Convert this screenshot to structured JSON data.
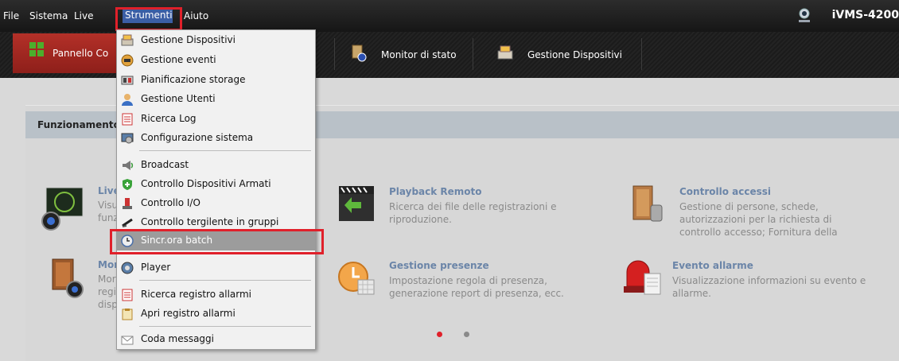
{
  "menubar": {
    "items": [
      "File",
      "Sistema",
      "Live",
      "Strumenti",
      "Aiuto"
    ],
    "active": "Strumenti",
    "brand": "iVMS-4200"
  },
  "toolbar": {
    "tabs": [
      {
        "label": "Pannello Co",
        "icon": "grid-icon",
        "active": true
      },
      {
        "label": "Monitor di stato",
        "icon": "status-monitor-icon"
      },
      {
        "label": "Gestione Dispositivi",
        "icon": "device-icon"
      }
    ]
  },
  "section": {
    "title": "Funzionamento"
  },
  "cards": [
    {
      "title": "Live",
      "desc": [
        "Visu",
        "funz"
      ]
    },
    {
      "title": "Mor",
      "desc": [
        "Mor",
        "regi",
        "disp"
      ]
    },
    {
      "title": "Playback Remoto",
      "desc": [
        "Ricerca dei file delle registrazioni e",
        "riproduzione."
      ]
    },
    {
      "title": "Gestione presenze",
      "desc": [
        "Impostazione regola di presenza,",
        "generazione report di presenza, ecc."
      ]
    },
    {
      "title": "Controllo accessi",
      "desc": [
        "Gestione di persone, schede,",
        "autorizzazioni per la richiesta di",
        "controllo accesso; Fornitura della"
      ]
    },
    {
      "title": "Evento allarme",
      "desc": [
        "Visualizzazione informazioni su evento e",
        "allarme."
      ]
    }
  ],
  "dropdown": {
    "items": [
      {
        "label": "Gestione Dispositivi",
        "icon": "device-icon"
      },
      {
        "label": "Gestione eventi",
        "icon": "event-icon"
      },
      {
        "label": "Pianificazione storage",
        "icon": "storage-icon"
      },
      {
        "label": "Gestione Utenti",
        "icon": "user-icon"
      },
      {
        "label": "Ricerca Log",
        "icon": "log-search-icon"
      },
      {
        "label": "Configurazione sistema",
        "icon": "system-config-icon"
      },
      {
        "label": "Broadcast",
        "icon": "broadcast-icon"
      },
      {
        "label": "Controllo Dispositivi Armati",
        "icon": "armed-shield-icon"
      },
      {
        "label": "Controllo I/O",
        "icon": "io-icon"
      },
      {
        "label": "Controllo tergilente in gruppi",
        "icon": "wiper-icon"
      },
      {
        "label": "Sincr.ora batch",
        "icon": "clock-icon",
        "highlighted": true
      },
      {
        "label": "Player",
        "icon": "player-icon"
      },
      {
        "label": "Ricerca registro allarmi",
        "icon": "alarm-log-search-icon"
      },
      {
        "label": "Apri registro allarmi",
        "icon": "alarm-log-open-icon"
      },
      {
        "label": "Coda messaggi",
        "icon": "message-queue-icon"
      }
    ]
  },
  "pagination": {
    "active_index": 0,
    "count": 2
  },
  "colors": {
    "accent_red": "#e0202a",
    "menu_highlight": "#3b5ea5",
    "tab_active": "#a4261f",
    "link_blue": "#6b85a8"
  }
}
